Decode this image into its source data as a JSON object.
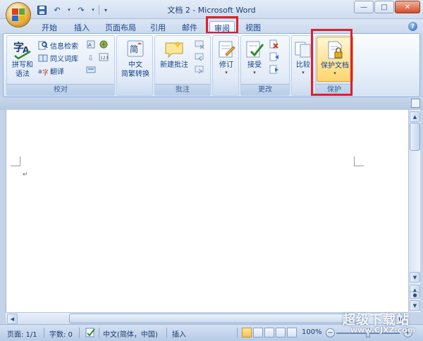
{
  "window": {
    "title": "文档 2 - Microsoft Word",
    "minimize": "—",
    "maximize": "□",
    "close": "✕"
  },
  "qat": {
    "undo": "↶",
    "redo": "↷",
    "customize": "▾"
  },
  "tabs": [
    {
      "label": "开始"
    },
    {
      "label": "插入"
    },
    {
      "label": "页面布局"
    },
    {
      "label": "引用"
    },
    {
      "label": "邮件"
    },
    {
      "label": "审阅",
      "active": true
    },
    {
      "label": "视图"
    }
  ],
  "help": "?",
  "ribbon": {
    "proofing": {
      "label": "校对",
      "spelling": "拼写和\n语法",
      "research": "信息检索",
      "thesaurus": "同义词库",
      "translate": "翻译"
    },
    "chinese": {
      "label": "中文\n简繁转换"
    },
    "comments": {
      "label": "批注",
      "new_comment": "新建批注"
    },
    "tracking": {
      "track_changes": "修订"
    },
    "changes": {
      "label": "更改",
      "accept": "接受"
    },
    "compare": {
      "compare": "比较"
    },
    "protect": {
      "label": "保护",
      "protect_document": "保护文档"
    },
    "dropdown": "▾"
  },
  "document": {
    "paragraph_mark": "↵"
  },
  "statusbar": {
    "page": "页面: 1/1",
    "words": "字数: 0",
    "language": "中文(简体，中国)",
    "mode": "插入",
    "zoom": "100%",
    "zoom_out": "−",
    "zoom_in": "+"
  },
  "watermark": {
    "brand": "超级下载站",
    "url": "www.CJXZ.com"
  },
  "colors": {
    "highlight": "#e01f2b",
    "ribbon_text": "#15428b"
  }
}
